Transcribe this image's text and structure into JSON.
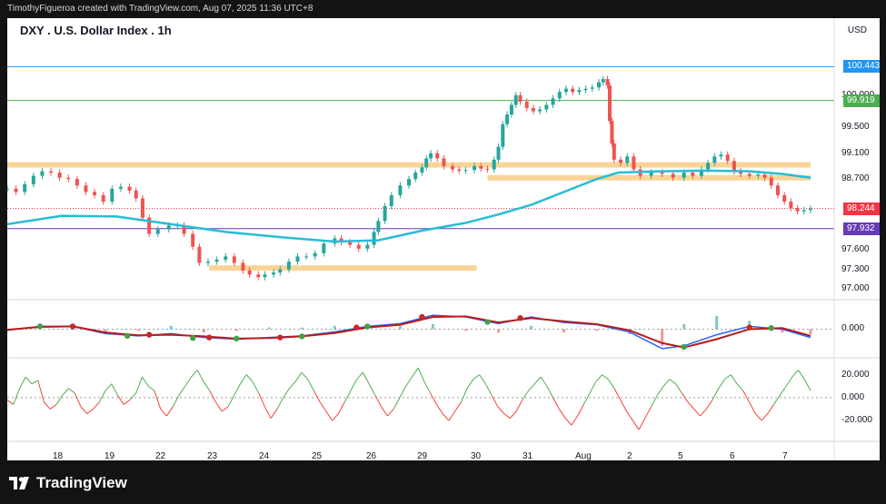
{
  "header": {
    "attribution": "TimothyFigueroa created with TradingView.com, Aug 07, 2025 11:36 UTC+8"
  },
  "chart_header": {
    "symbol_title": "DXY . U.S. Dollar Index . 1h",
    "currency": "USD"
  },
  "footer": {
    "logo_text": "TradingView"
  },
  "colors": {
    "up_candle": "#26a69a",
    "down_candle": "#ef5350",
    "ma_line": "#26bdd6",
    "support_zone": "#f5b041",
    "macd_line": "#2962ff",
    "signal_line": "#b71c1c",
    "rsi_up": "#4caf50",
    "rsi_down": "#f44336"
  },
  "chart_data": [
    {
      "type": "line",
      "title": "DXY . U.S. Dollar Index . 1h",
      "price_axis_ticks": [
        "100.000",
        "99.500",
        "99.100",
        "98.700",
        "97.600",
        "97.300",
        "97.000"
      ],
      "price_tags": [
        {
          "label": "100.443",
          "value": 100.443,
          "color": "#2196f3"
        },
        {
          "label": "99.919",
          "value": 99.919,
          "color": "#4caf50"
        },
        {
          "label": "98.244",
          "value": 98.244,
          "color": "#f23645"
        },
        {
          "label": "97.932",
          "value": 97.932,
          "color": "#673ab7"
        }
      ],
      "horizontal_lines": [
        {
          "value": 100.443,
          "color": "#2196f3"
        },
        {
          "value": 99.919,
          "color": "#4caf50"
        },
        {
          "value": 97.932,
          "color": "#673ab7"
        }
      ],
      "ylim": [
        96.9,
        100.8
      ],
      "x_ticks": [
        "18",
        "19",
        "22",
        "23",
        "24",
        "25",
        "26",
        "29",
        "30",
        "31",
        "Aug",
        "2",
        "5",
        "6",
        "7"
      ],
      "close_path": [
        [
          0,
          98.55
        ],
        [
          8,
          98.5
        ],
        [
          16,
          98.62
        ],
        [
          24,
          98.75
        ],
        [
          32,
          98.82
        ],
        [
          40,
          98.8
        ],
        [
          48,
          98.72
        ],
        [
          56,
          98.7
        ],
        [
          64,
          98.6
        ],
        [
          72,
          98.5
        ],
        [
          80,
          98.45
        ],
        [
          88,
          98.35
        ],
        [
          96,
          98.55
        ],
        [
          104,
          98.58
        ],
        [
          112,
          98.52
        ],
        [
          118,
          98.4
        ],
        [
          124,
          98.1
        ],
        [
          130,
          97.85
        ],
        [
          138,
          97.92
        ],
        [
          148,
          97.98
        ],
        [
          156,
          97.98
        ],
        [
          162,
          97.85
        ],
        [
          170,
          97.65
        ],
        [
          176,
          97.4
        ],
        [
          184,
          97.42
        ],
        [
          192,
          97.45
        ],
        [
          200,
          97.5
        ],
        [
          208,
          97.4
        ],
        [
          216,
          97.28
        ],
        [
          222,
          97.22
        ],
        [
          230,
          97.18
        ],
        [
          236,
          97.22
        ],
        [
          244,
          97.25
        ],
        [
          250,
          97.3
        ],
        [
          258,
          97.42
        ],
        [
          266,
          97.5
        ],
        [
          274,
          97.5
        ],
        [
          282,
          97.55
        ],
        [
          290,
          97.7
        ],
        [
          300,
          97.78
        ],
        [
          306,
          97.72
        ],
        [
          314,
          97.68
        ],
        [
          322,
          97.62
        ],
        [
          330,
          97.68
        ],
        [
          336,
          97.88
        ],
        [
          340,
          98.05
        ],
        [
          346,
          98.28
        ],
        [
          352,
          98.45
        ],
        [
          360,
          98.6
        ],
        [
          368,
          98.7
        ],
        [
          374,
          98.8
        ],
        [
          380,
          98.88
        ],
        [
          384,
          99.02
        ],
        [
          388,
          99.1
        ],
        [
          394,
          99.02
        ],
        [
          400,
          98.9
        ],
        [
          408,
          98.85
        ],
        [
          414,
          98.83
        ],
        [
          420,
          98.84
        ],
        [
          428,
          98.9
        ],
        [
          434,
          98.86
        ],
        [
          440,
          98.85
        ],
        [
          446,
          99.0
        ],
        [
          450,
          99.2
        ],
        [
          454,
          99.55
        ],
        [
          458,
          99.7
        ],
        [
          462,
          99.85
        ],
        [
          466,
          100.0
        ],
        [
          470,
          99.9
        ],
        [
          476,
          99.8
        ],
        [
          482,
          99.75
        ],
        [
          488,
          99.78
        ],
        [
          494,
          99.85
        ],
        [
          500,
          99.95
        ],
        [
          506,
          100.05
        ],
        [
          512,
          100.1
        ],
        [
          518,
          100.05
        ],
        [
          524,
          100.08
        ],
        [
          530,
          100.1
        ],
        [
          536,
          100.12
        ],
        [
          542,
          100.2
        ],
        [
          546,
          100.25
        ],
        [
          550,
          100.15
        ],
        [
          552,
          99.6
        ],
        [
          554,
          99.25
        ],
        [
          556,
          99.0
        ],
        [
          562,
          98.95
        ],
        [
          568,
          99.05
        ],
        [
          574,
          98.85
        ],
        [
          580,
          98.75
        ],
        [
          590,
          98.8
        ],
        [
          600,
          98.78
        ],
        [
          610,
          98.72
        ],
        [
          620,
          98.8
        ],
        [
          628,
          98.75
        ],
        [
          636,
          98.85
        ],
        [
          642,
          98.95
        ],
        [
          648,
          99.05
        ],
        [
          654,
          99.08
        ],
        [
          660,
          98.98
        ],
        [
          666,
          98.82
        ],
        [
          672,
          98.78
        ],
        [
          680,
          98.75
        ],
        [
          688,
          98.77
        ],
        [
          694,
          98.72
        ],
        [
          700,
          98.6
        ],
        [
          706,
          98.45
        ],
        [
          712,
          98.35
        ],
        [
          718,
          98.25
        ],
        [
          724,
          98.2
        ],
        [
          730,
          98.22
        ],
        [
          736,
          98.24
        ]
      ],
      "moving_average": [
        [
          0,
          98.0
        ],
        [
          50,
          98.13
        ],
        [
          100,
          98.12
        ],
        [
          150,
          98.0
        ],
        [
          200,
          97.88
        ],
        [
          250,
          97.8
        ],
        [
          300,
          97.73
        ],
        [
          340,
          97.75
        ],
        [
          380,
          97.9
        ],
        [
          420,
          98.02
        ],
        [
          450,
          98.15
        ],
        [
          480,
          98.3
        ],
        [
          510,
          98.5
        ],
        [
          540,
          98.7
        ],
        [
          560,
          98.8
        ],
        [
          600,
          98.82
        ],
        [
          640,
          98.83
        ],
        [
          680,
          98.82
        ],
        [
          710,
          98.78
        ],
        [
          736,
          98.72
        ]
      ],
      "support_zones": [
        {
          "from": 0,
          "to": 736,
          "value": 98.92
        },
        {
          "from": 440,
          "to": 736,
          "value": 98.72
        },
        {
          "from": 185,
          "to": 430,
          "value": 97.32
        }
      ]
    },
    {
      "type": "line",
      "title": "",
      "y_ticks": [
        "0.000"
      ],
      "ylim": [
        -0.45,
        0.4
      ],
      "series": [
        {
          "values_path": [
            [
              0,
              -0.02
            ],
            [
              30,
              0.05
            ],
            [
              60,
              0.05
            ],
            [
              90,
              -0.08
            ],
            [
              120,
              -0.12
            ],
            [
              150,
              -0.08
            ],
            [
              180,
              -0.15
            ],
            [
              210,
              -0.18
            ],
            [
              240,
              -0.15
            ],
            [
              270,
              -0.12
            ],
            [
              300,
              -0.05
            ],
            [
              330,
              0.05
            ],
            [
              360,
              0.1
            ],
            [
              390,
              0.25
            ],
            [
              420,
              0.22
            ],
            [
              450,
              0.1
            ],
            [
              480,
              0.22
            ],
            [
              510,
              0.12
            ],
            [
              540,
              0.08
            ],
            [
              570,
              -0.05
            ],
            [
              600,
              -0.35
            ],
            [
              620,
              -0.3
            ],
            [
              650,
              -0.1
            ],
            [
              680,
              0.05
            ],
            [
              710,
              0.0
            ],
            [
              736,
              -0.15
            ]
          ]
        },
        {
          "values_path": [
            [
              0,
              -0.01
            ],
            [
              30,
              0.04
            ],
            [
              60,
              0.05
            ],
            [
              90,
              -0.06
            ],
            [
              120,
              -0.11
            ],
            [
              150,
              -0.1
            ],
            [
              180,
              -0.13
            ],
            [
              210,
              -0.17
            ],
            [
              240,
              -0.16
            ],
            [
              270,
              -0.13
            ],
            [
              300,
              -0.07
            ],
            [
              330,
              0.03
            ],
            [
              360,
              0.08
            ],
            [
              390,
              0.22
            ],
            [
              420,
              0.23
            ],
            [
              450,
              0.12
            ],
            [
              480,
              0.2
            ],
            [
              510,
              0.14
            ],
            [
              540,
              0.09
            ],
            [
              570,
              -0.02
            ],
            [
              600,
              -0.25
            ],
            [
              620,
              -0.33
            ],
            [
              650,
              -0.18
            ],
            [
              680,
              0.0
            ],
            [
              710,
              0.02
            ],
            [
              736,
              -0.12
            ]
          ]
        }
      ],
      "crossover_markers": [
        [
          30,
          0.05
        ],
        [
          60,
          0.05
        ],
        [
          110,
          -0.12
        ],
        [
          130,
          -0.1
        ],
        [
          170,
          -0.16
        ],
        [
          185,
          -0.15
        ],
        [
          210,
          -0.17
        ],
        [
          250,
          -0.15
        ],
        [
          270,
          -0.13
        ],
        [
          320,
          0.03
        ],
        [
          330,
          0.05
        ],
        [
          380,
          0.22
        ],
        [
          440,
          0.13
        ],
        [
          470,
          0.2
        ],
        [
          620,
          -0.32
        ],
        [
          680,
          0.03
        ],
        [
          700,
          0.02
        ]
      ]
    },
    {
      "type": "line",
      "title": "",
      "y_ticks": [
        "20.000",
        "0.000",
        "-20.000"
      ],
      "ylim": [
        -35,
        30
      ],
      "values": [
        -2,
        -6,
        8,
        18,
        12,
        15,
        -4,
        -10,
        -6,
        2,
        8,
        4,
        -8,
        -14,
        -10,
        -4,
        6,
        12,
        2,
        -6,
        -2,
        4,
        18,
        10,
        6,
        -10,
        -16,
        -8,
        2,
        10,
        18,
        24,
        14,
        6,
        -4,
        -12,
        -8,
        2,
        12,
        20,
        14,
        4,
        -8,
        -18,
        -10,
        0,
        8,
        14,
        22,
        16,
        6,
        -4,
        -12,
        -20,
        -14,
        -4,
        6,
        16,
        22,
        12,
        2,
        -8,
        -16,
        -10,
        0,
        10,
        18,
        26,
        14,
        4,
        -6,
        -14,
        -20,
        -12,
        -4,
        8,
        16,
        20,
        12,
        2,
        -8,
        -14,
        -18,
        -12,
        -2,
        6,
        12,
        18,
        10,
        0,
        -10,
        -18,
        -24,
        -16,
        -6,
        4,
        14,
        20,
        16,
        8,
        -2,
        -12,
        -20,
        -28,
        -18,
        -8,
        2,
        10,
        16,
        12,
        4,
        -4,
        -10,
        -16,
        -10,
        -2,
        8,
        16,
        20,
        12,
        6,
        -4,
        -14,
        -20,
        -14,
        -6,
        2,
        10,
        18,
        24,
        16,
        6
      ]
    }
  ]
}
